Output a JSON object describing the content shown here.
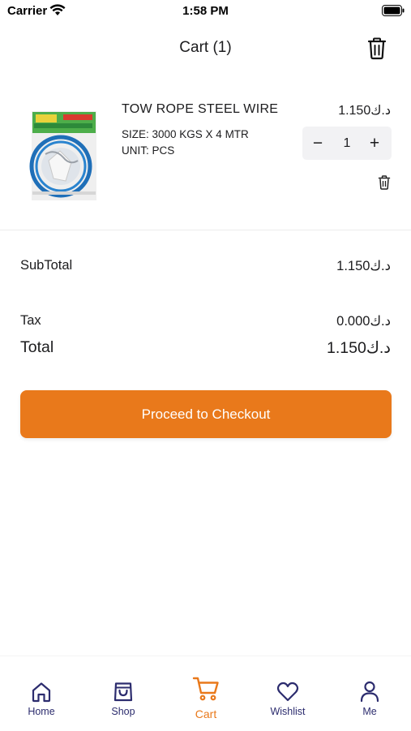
{
  "status_bar": {
    "carrier": "Carrier",
    "time": "1:58 PM"
  },
  "header": {
    "title": "Cart (1)",
    "clear_icon": "trash-icon"
  },
  "cart_items": [
    {
      "name": "TOW ROPE STEEL WIRE",
      "price": "1.150د.ك",
      "size": "SIZE: 3000 KGS X 4 MTR",
      "unit": "UNIT: PCS",
      "quantity": "1",
      "decrement_label": "−",
      "increment_label": "+"
    }
  ],
  "summary": {
    "subtotal_label": "SubTotal",
    "subtotal_value": "1.150د.ك",
    "tax_label": "Tax",
    "tax_value": "0.000د.ك",
    "total_label": "Total",
    "total_value": "1.150د.ك"
  },
  "checkout": {
    "label": "Proceed to Checkout"
  },
  "tabs": [
    {
      "label": "Home",
      "icon": "home-icon",
      "active": false
    },
    {
      "label": "Shop",
      "icon": "shopping-bag-icon",
      "active": false
    },
    {
      "label": "Cart",
      "icon": "cart-icon",
      "active": true
    },
    {
      "label": "Wishlist",
      "icon": "heart-icon",
      "active": false
    },
    {
      "label": "Me",
      "icon": "user-icon",
      "active": false
    }
  ],
  "colors": {
    "accent": "#e9791b",
    "tab_inactive": "#2c2c6e",
    "stepper_bg": "#f2f2f4"
  }
}
